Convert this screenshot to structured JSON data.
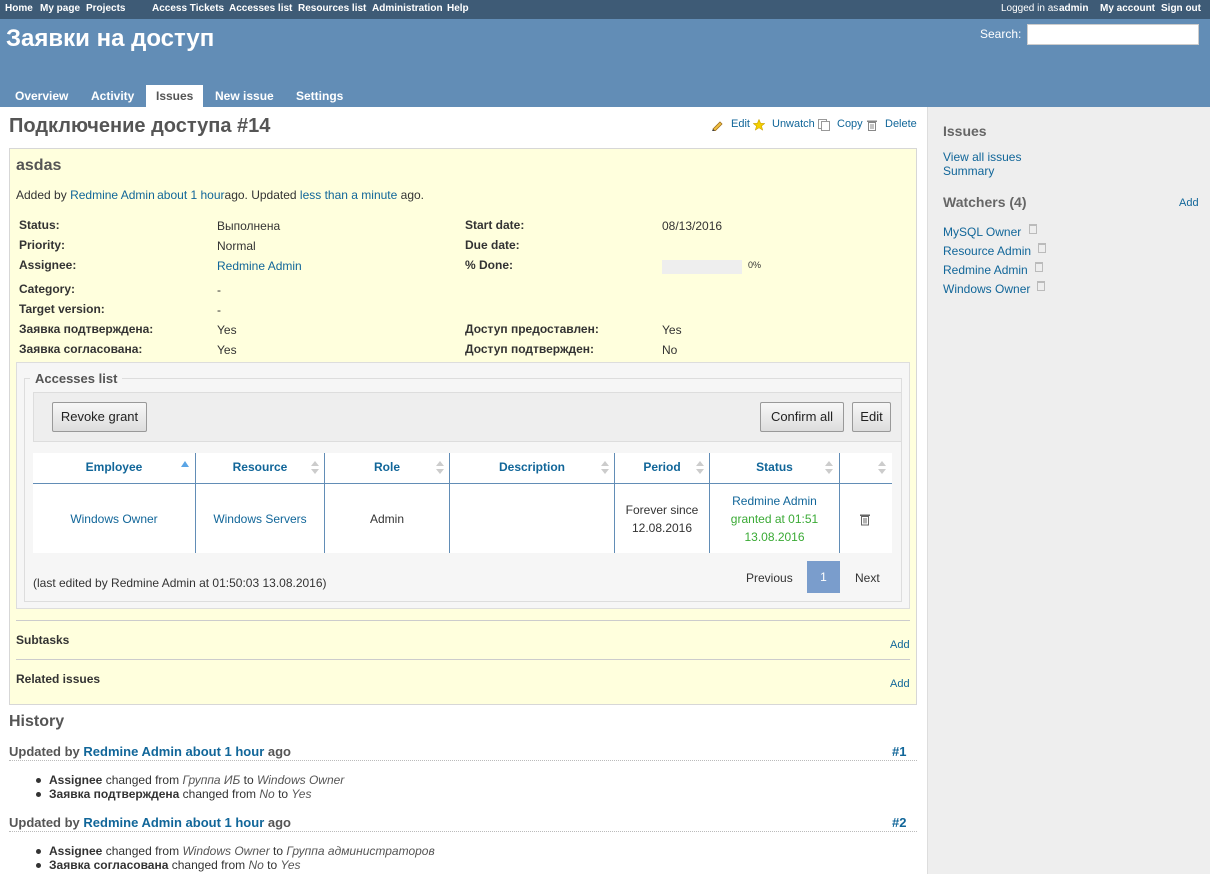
{
  "top_menu": {
    "home": "Home",
    "my_page": "My page",
    "projects": "Projects",
    "access_tickets": "Access Tickets",
    "accesses_list": "Accesses list",
    "resources_list": "Resources list",
    "administration": "Administration",
    "help": "Help",
    "logged_in_as": "Logged in as",
    "user": "admin",
    "my_account": "My account",
    "sign_out": "Sign out"
  },
  "header": {
    "title": "Заявки на доступ",
    "search_label": "Search:"
  },
  "main_menu": {
    "overview": "Overview",
    "activity": "Activity",
    "issues": "Issues",
    "new_issue": "New issue",
    "settings": "Settings"
  },
  "page": {
    "title": "Подключение доступа #14",
    "edit": "Edit",
    "unwatch": "Unwatch",
    "copy": "Copy",
    "delete": "Delete"
  },
  "issue": {
    "subject": "asdas",
    "added_by_prefix": "Added by",
    "author": "Redmine Admin",
    "added_ago": "about 1 hour",
    "ago1": "ago. Updated",
    "updated_ago": "less than a minute",
    "ago2": "ago.",
    "status_l": "Status:",
    "status_v": "Выполнена",
    "priority_l": "Priority:",
    "priority_v": "Normal",
    "assignee_l": "Assignee:",
    "assignee_v": "Redmine Admin",
    "category_l": "Category:",
    "category_v": "-",
    "target_l": "Target version:",
    "target_v": "-",
    "confirmed_l": "Заявка подтверждена:",
    "confirmed_v": "Yes",
    "agreed_l": "Заявка согласована:",
    "agreed_v": "Yes",
    "start_l": "Start date:",
    "start_v": "08/13/2016",
    "due_l": "Due date:",
    "due_v": "",
    "done_l": "% Done:",
    "done_v": "0%",
    "done_fraction": 0,
    "granted_l": "Доступ предоставлен:",
    "granted_v": "Yes",
    "access_confirmed_l": "Доступ подтвержден:",
    "access_confirmed_v": "No"
  },
  "accesses": {
    "legend": "Accesses list",
    "revoke": "Revoke grant",
    "confirm_all": "Confirm all",
    "edit": "Edit",
    "columns": [
      "Employee",
      "Resource",
      "Role",
      "Description",
      "Period",
      "Status"
    ],
    "row": {
      "employee": "Windows Owner",
      "resource": "Windows Servers",
      "role": "Admin",
      "description": "",
      "period_1": "Forever since",
      "period_2": "12.08.2016",
      "status_by": "Redmine Admin",
      "status_1": "granted at 01:51",
      "status_2": "13.08.2016"
    },
    "last_edited": "(last edited by Redmine Admin at 01:50:03 13.08.2016)",
    "prev": "Previous",
    "page": "1",
    "next": "Next"
  },
  "subtasks": {
    "title": "Subtasks",
    "add": "Add"
  },
  "related": {
    "title": "Related issues",
    "add": "Add"
  },
  "history": {
    "title": "History",
    "j1": {
      "prefix": "Updated by",
      "user": "Redmine Admin",
      "time": "about 1 hour",
      "suffix": "ago",
      "num": "#1",
      "d1": {
        "field": "Assignee",
        "changed": "changed from",
        "from": "Группа ИБ",
        "to_w": "to",
        "to": "Windows Owner"
      },
      "d2": {
        "field": "Заявка подтверждена",
        "changed": "changed from",
        "from": "No",
        "to_w": "to",
        "to": "Yes"
      }
    },
    "j2": {
      "prefix": "Updated by",
      "user": "Redmine Admin",
      "time": "about 1 hour",
      "suffix": "ago",
      "num": "#2",
      "d1": {
        "field": "Assignee",
        "changed": "changed from",
        "from": "Windows Owner",
        "to_w": "to",
        "to": "Группа администраторов"
      },
      "d2": {
        "field": "Заявка согласована",
        "changed": "changed from",
        "from": "No",
        "to_w": "to",
        "to": "Yes"
      }
    }
  },
  "sidebar": {
    "issues_title": "Issues",
    "view_all": "View all issues",
    "summary": "Summary",
    "watchers_title": "Watchers (4)",
    "add": "Add",
    "watchers": [
      "MySQL Owner",
      "Resource Admin",
      "Redmine Admin",
      "Windows Owner"
    ]
  }
}
